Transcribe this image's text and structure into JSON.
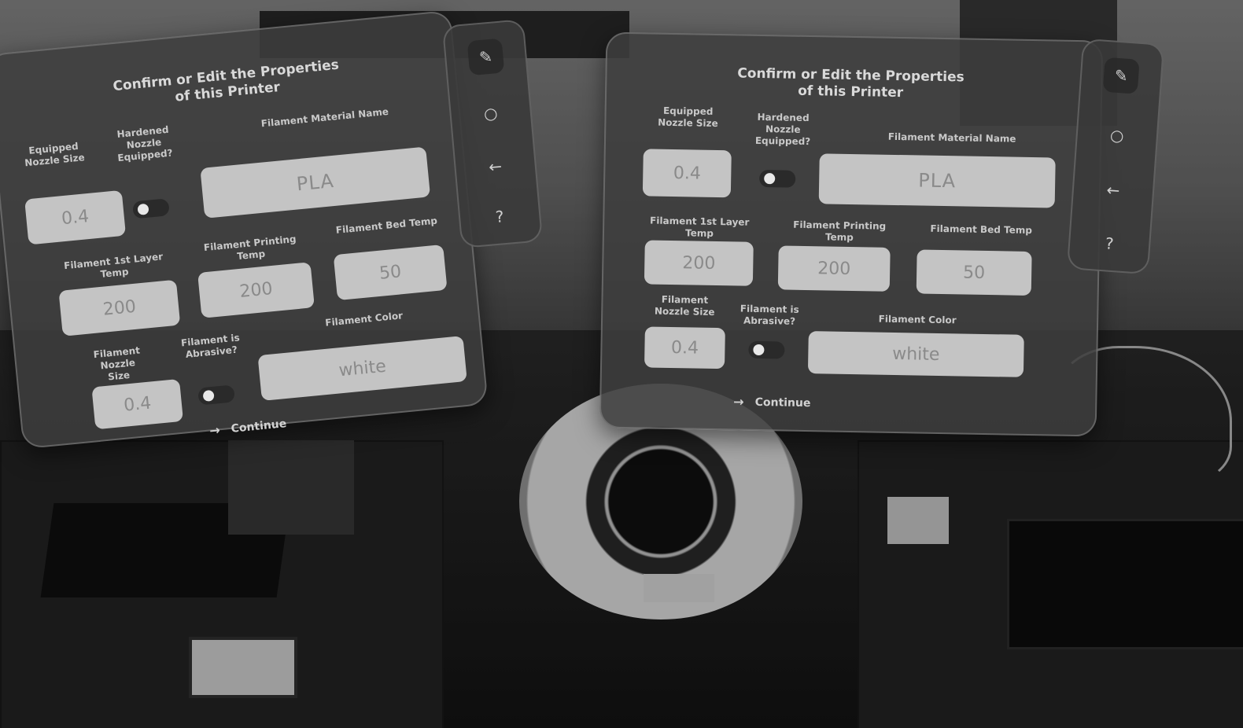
{
  "panels": [
    {
      "title_line1": "Confirm or Edit the Properties",
      "title_line2": "of this Printer",
      "equipped_nozzle_label": "Equipped Nozzle Size",
      "equipped_nozzle_value": "0.4",
      "hardened_nozzle_label": "Hardened Nozzle Equipped?",
      "hardened_nozzle_on": false,
      "filament_material_label": "Filament Material Name",
      "filament_material_value": "PLA",
      "first_layer_label": "Filament 1st Layer Temp",
      "first_layer_value": "200",
      "printing_temp_label": "Filament Printing Temp",
      "printing_temp_value": "200",
      "bed_temp_label": "Filament Bed Temp",
      "bed_temp_value": "50",
      "filament_nozzle_label": "Filament Nozzle Size",
      "filament_nozzle_value": "0.4",
      "abrasive_label": "Filament is Abrasive?",
      "abrasive_on": false,
      "filament_color_label": "Filament Color",
      "filament_color_value": "white",
      "continue_label": "Continue"
    },
    {
      "title_line1": "Confirm or Edit the Properties",
      "title_line2": "of this Printer",
      "equipped_nozzle_label": "Equipped Nozzle Size",
      "equipped_nozzle_value": "0.4",
      "hardened_nozzle_label": "Hardened Nozzle Equipped?",
      "hardened_nozzle_on": false,
      "filament_material_label": "Filament Material Name",
      "filament_material_value": "PLA",
      "first_layer_label": "Filament 1st Layer Temp",
      "first_layer_value": "200",
      "printing_temp_label": "Filament Printing Temp",
      "printing_temp_value": "200",
      "bed_temp_label": "Filament Bed Temp",
      "bed_temp_value": "50",
      "filament_nozzle_label": "Filament Nozzle Size",
      "filament_nozzle_value": "0.4",
      "abrasive_label": "Filament is Abrasive?",
      "abrasive_on": false,
      "filament_color_label": "Filament Color",
      "filament_color_value": "white",
      "continue_label": "Continue"
    }
  ],
  "toolbar_icons": [
    "pencil-icon",
    "circle-icon",
    "back-arrow-icon",
    "help-icon"
  ],
  "icon_glyphs": {
    "pencil": "✎",
    "circle": "○",
    "back": "←",
    "help": "?",
    "continue_arrow": "→"
  },
  "colors": {
    "panel_bg": "#3e3e3e",
    "field_bg": "#c4c4c4",
    "field_text": "#8a8a8a",
    "label_text": "#c9c9c9"
  }
}
